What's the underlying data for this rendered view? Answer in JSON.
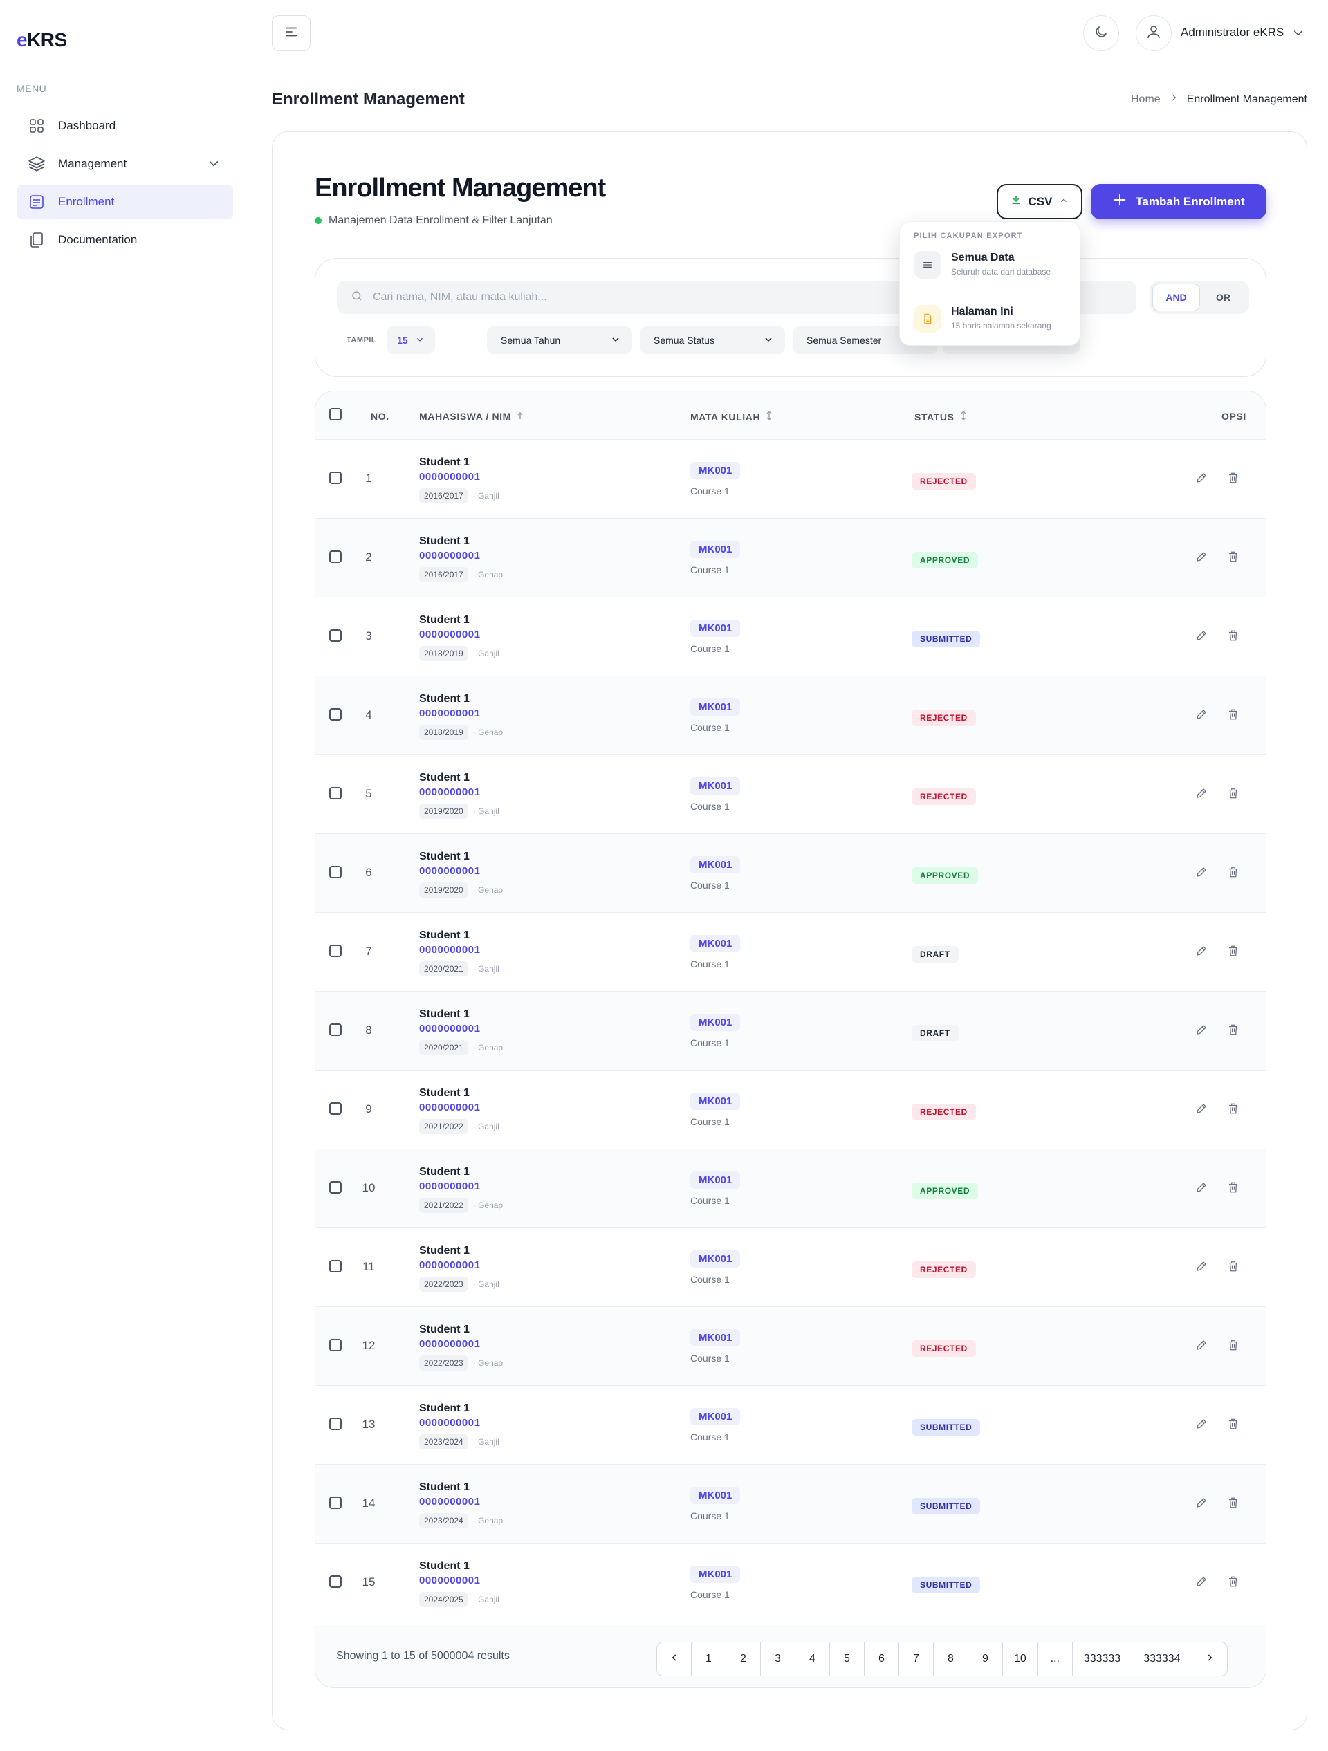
{
  "app": {
    "logo_e": "e",
    "logo_rest": "KRS"
  },
  "sidebar": {
    "menu_label": "MENU",
    "items": [
      {
        "label": "Dashboard",
        "icon": "grid-icon"
      },
      {
        "label": "Management",
        "icon": "layers-icon"
      },
      {
        "label": "Enrollment",
        "icon": "list-box-icon",
        "active": true
      },
      {
        "label": "Documentation",
        "icon": "document-copy-icon"
      }
    ]
  },
  "header": {
    "user_name": "Administrator eKRS"
  },
  "page": {
    "title": "Enrollment Management",
    "breadcrumb": {
      "home": "Home",
      "current": "Enrollment Management"
    }
  },
  "card": {
    "title": "Enrollment Management",
    "subtitle": "Manajemen Data Enrollment & Filter Lanjutan",
    "csv_label": "CSV",
    "add_label": "Tambah Enrollment"
  },
  "export_menu": {
    "heading": "PILIH CAKUPAN EXPORT",
    "options": [
      {
        "title": "Semua Data",
        "desc": "Seluruh data dari database"
      },
      {
        "title": "Halaman Ini",
        "desc": "15 baris halaman sekarang"
      }
    ]
  },
  "filters": {
    "search_placeholder": "Cari nama, NIM, atau mata kuliah...",
    "logic": [
      "AND",
      "OR"
    ],
    "tampil_label": "TAMPIL",
    "tampil_value": "15",
    "tahun": "Semua Tahun",
    "status": "Semua Status",
    "semester": "Semua Semester"
  },
  "table": {
    "headers": {
      "no": "NO.",
      "mahasiswa": "MAHASISWA / NIM",
      "mk": "MATA KULIAH",
      "status": "STATUS",
      "opsi": "OPSI"
    },
    "rows": [
      {
        "no": "1",
        "name": "Student 1",
        "nim": "0000000001",
        "year": "2016/2017",
        "sem": "· Ganjil",
        "code": "MK001",
        "course": "Course 1",
        "status": "REJECTED"
      },
      {
        "no": "2",
        "name": "Student 1",
        "nim": "0000000001",
        "year": "2016/2017",
        "sem": "· Genap",
        "code": "MK001",
        "course": "Course 1",
        "status": "APPROVED"
      },
      {
        "no": "3",
        "name": "Student 1",
        "nim": "0000000001",
        "year": "2018/2019",
        "sem": "· Ganjil",
        "code": "MK001",
        "course": "Course 1",
        "status": "SUBMITTED"
      },
      {
        "no": "4",
        "name": "Student 1",
        "nim": "0000000001",
        "year": "2018/2019",
        "sem": "· Genap",
        "code": "MK001",
        "course": "Course 1",
        "status": "REJECTED"
      },
      {
        "no": "5",
        "name": "Student 1",
        "nim": "0000000001",
        "year": "2019/2020",
        "sem": "· Ganjil",
        "code": "MK001",
        "course": "Course 1",
        "status": "REJECTED"
      },
      {
        "no": "6",
        "name": "Student 1",
        "nim": "0000000001",
        "year": "2019/2020",
        "sem": "· Genap",
        "code": "MK001",
        "course": "Course 1",
        "status": "APPROVED"
      },
      {
        "no": "7",
        "name": "Student 1",
        "nim": "0000000001",
        "year": "2020/2021",
        "sem": "· Ganjil",
        "code": "MK001",
        "course": "Course 1",
        "status": "DRAFT"
      },
      {
        "no": "8",
        "name": "Student 1",
        "nim": "0000000001",
        "year": "2020/2021",
        "sem": "· Genap",
        "code": "MK001",
        "course": "Course 1",
        "status": "DRAFT"
      },
      {
        "no": "9",
        "name": "Student 1",
        "nim": "0000000001",
        "year": "2021/2022",
        "sem": "· Ganjil",
        "code": "MK001",
        "course": "Course 1",
        "status": "REJECTED"
      },
      {
        "no": "10",
        "name": "Student 1",
        "nim": "0000000001",
        "year": "2021/2022",
        "sem": "· Genap",
        "code": "MK001",
        "course": "Course 1",
        "status": "APPROVED"
      },
      {
        "no": "11",
        "name": "Student 1",
        "nim": "0000000001",
        "year": "2022/2023",
        "sem": "· Ganjil",
        "code": "MK001",
        "course": "Course 1",
        "status": "REJECTED"
      },
      {
        "no": "12",
        "name": "Student 1",
        "nim": "0000000001",
        "year": "2022/2023",
        "sem": "· Genap",
        "code": "MK001",
        "course": "Course 1",
        "status": "REJECTED"
      },
      {
        "no": "13",
        "name": "Student 1",
        "nim": "0000000001",
        "year": "2023/2024",
        "sem": "· Ganjil",
        "code": "MK001",
        "course": "Course 1",
        "status": "SUBMITTED"
      },
      {
        "no": "14",
        "name": "Student 1",
        "nim": "0000000001",
        "year": "2023/2024",
        "sem": "· Genap",
        "code": "MK001",
        "course": "Course 1",
        "status": "SUBMITTED"
      },
      {
        "no": "15",
        "name": "Student 1",
        "nim": "0000000001",
        "year": "2024/2025",
        "sem": "· Ganjil",
        "code": "MK001",
        "course": "Course 1",
        "status": "SUBMITTED"
      }
    ],
    "showing": "Showing 1 to 15 of 5000004 results",
    "pages": [
      "1",
      "2",
      "3",
      "4",
      "5",
      "6",
      "7",
      "8",
      "9",
      "10",
      "...",
      "333333",
      "333334"
    ]
  },
  "colors": {
    "accent": "#4f46e5",
    "rejected": "#c8102e",
    "approved": "#15803d",
    "submitted": "#3730a3"
  }
}
